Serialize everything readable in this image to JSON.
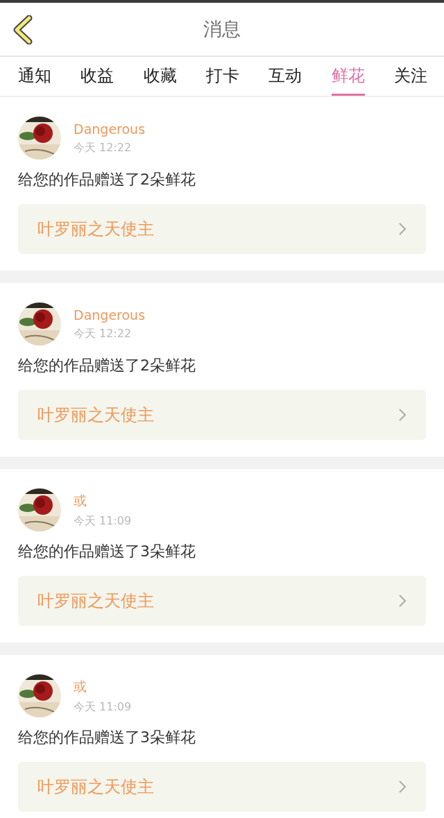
{
  "header": {
    "title": "消息"
  },
  "tabs": [
    {
      "label": "通知",
      "selected": false
    },
    {
      "label": "收益",
      "selected": false
    },
    {
      "label": "收藏",
      "selected": false
    },
    {
      "label": "打卡",
      "selected": false
    },
    {
      "label": "互动",
      "selected": false
    },
    {
      "label": "鲜花",
      "selected": true
    },
    {
      "label": "关注",
      "selected": false
    }
  ],
  "messages": [
    {
      "name": "Dangerous",
      "time": "今天 12:22",
      "text": "给您的作品赠送了2朵鲜花",
      "work": "叶罗丽之天使主"
    },
    {
      "name": "Dangerous",
      "time": "今天 12:22",
      "text": "给您的作品赠送了2朵鲜花",
      "work": "叶罗丽之天使主"
    },
    {
      "name": "或",
      "time": "今天 11:09",
      "text": "给您的作品赠送了3朵鲜花",
      "work": "叶罗丽之天使主"
    },
    {
      "name": "或",
      "time": "今天 11:09",
      "text": "给您的作品赠送了3朵鲜花",
      "work": "叶罗丽之天使主"
    }
  ]
}
